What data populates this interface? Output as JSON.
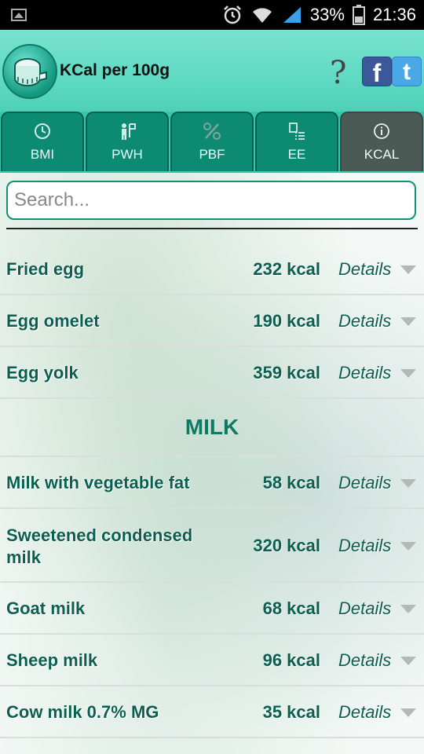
{
  "status_bar": {
    "battery": "33%",
    "time": "21:36"
  },
  "header": {
    "title": "KCal per 100g",
    "help_glyph": "?",
    "facebook_glyph": "f",
    "twitter_glyph": "t"
  },
  "tabs": [
    {
      "label": "BMI",
      "icon": "clock-icon",
      "active": false
    },
    {
      "label": "PWH",
      "icon": "person-flag-icon",
      "active": false
    },
    {
      "label": "PBF",
      "icon": "percent-icon",
      "active": false
    },
    {
      "label": "EE",
      "icon": "checklist-icon",
      "active": false
    },
    {
      "label": "KCAL",
      "icon": "info-icon",
      "active": true
    }
  ],
  "search": {
    "placeholder": "Search..."
  },
  "items": [
    {
      "name": "Fried egg",
      "kcal": "232 kcal",
      "details": "Details"
    },
    {
      "name": "Egg omelet",
      "kcal": "190 kcal",
      "details": "Details"
    },
    {
      "name": "Egg yolk",
      "kcal": "359 kcal",
      "details": "Details"
    }
  ],
  "section": {
    "title": "MILK"
  },
  "milk_items": [
    {
      "name": "Milk with vegetable fat",
      "kcal": "58 kcal",
      "details": "Details"
    },
    {
      "name": "Sweetened condensed milk",
      "kcal": "320 kcal",
      "details": "Details"
    },
    {
      "name": "Goat milk",
      "kcal": "68 kcal",
      "details": "Details"
    },
    {
      "name": "Sheep milk",
      "kcal": "96 kcal",
      "details": "Details"
    },
    {
      "name": "Cow milk 0.7% MG",
      "kcal": "35 kcal",
      "details": "Details"
    }
  ]
}
